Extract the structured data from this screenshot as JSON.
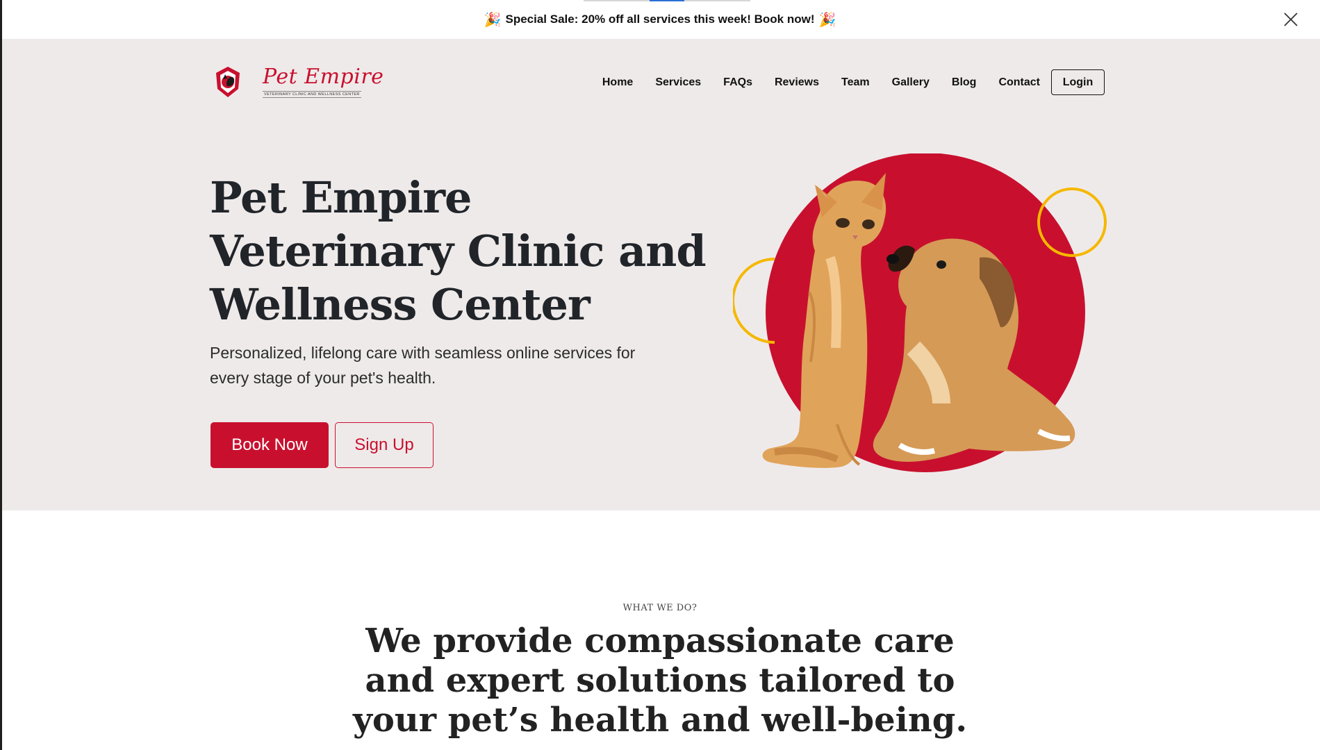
{
  "promo": {
    "emoji": "🎉",
    "text": "Special Sale: 20% off all services this week! Book now!"
  },
  "brand": {
    "name": "Pet Empire",
    "tagline": "VETERINARY CLINIC AND WELLNESS CENTER",
    "accent_color": "#c8102e",
    "highlight_color": "#f5b800"
  },
  "nav": {
    "items": [
      {
        "label": "Home"
      },
      {
        "label": "Services"
      },
      {
        "label": "FAQs"
      },
      {
        "label": "Reviews"
      },
      {
        "label": "Team"
      },
      {
        "label": "Gallery"
      },
      {
        "label": "Blog"
      },
      {
        "label": "Contact"
      }
    ],
    "login_label": "Login"
  },
  "hero": {
    "title_lines": [
      "Pet Empire",
      "Veterinary Clinic and",
      "Wellness Center"
    ],
    "subtitle": "Personalized, lifelong care with seamless online services for every stage of your pet's health.",
    "book_label": "Book Now",
    "signup_label": "Sign Up"
  },
  "about": {
    "eyebrow": "WHAT WE DO?",
    "heading_lines": [
      "We provide compassionate care",
      "and expert solutions tailored to",
      "your pet’s health and well-being."
    ]
  },
  "icons": {
    "close": "close-icon",
    "logo": "shield-pet-logo-icon"
  }
}
